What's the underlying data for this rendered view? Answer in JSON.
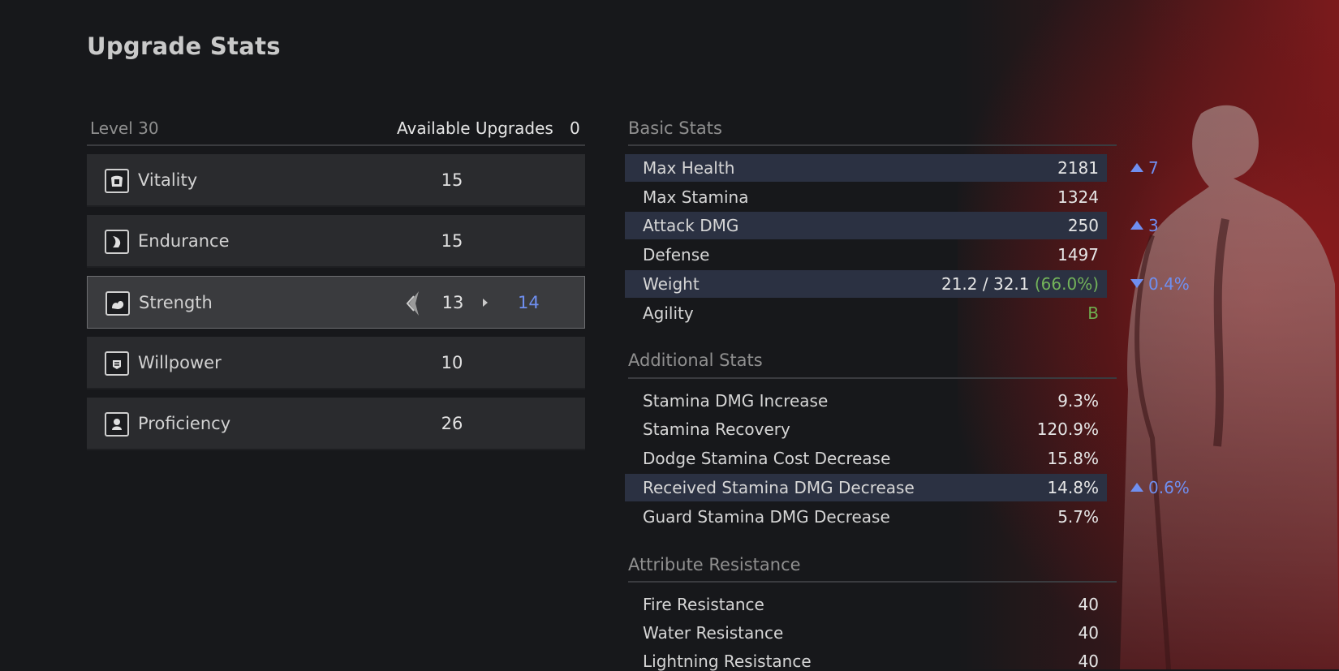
{
  "screen": {
    "title": "Upgrade Stats"
  },
  "colors": {
    "accent_blue": "#6f8ff0",
    "good_green": "#73b35a",
    "highlight_row": "#2b3142"
  },
  "left_panel": {
    "level_label": "Level 30",
    "available_label": "Available Upgrades",
    "available_value": "0",
    "attributes": [
      {
        "name": "Vitality",
        "value": "15",
        "icon": "vitality-icon"
      },
      {
        "name": "Endurance",
        "value": "15",
        "icon": "endurance-icon"
      },
      {
        "name": "Strength",
        "value": "13",
        "new_value": "14",
        "icon": "strength-icon",
        "selected": true
      },
      {
        "name": "Willpower",
        "value": "10",
        "icon": "willpower-icon"
      },
      {
        "name": "Proficiency",
        "value": "26",
        "icon": "proficiency-icon"
      }
    ]
  },
  "basic_stats": {
    "heading": "Basic Stats",
    "rows": [
      {
        "label": "Max Health",
        "value": "2181",
        "delta": "7",
        "dir": "up",
        "highlight": true
      },
      {
        "label": "Max Stamina",
        "value": "1324"
      },
      {
        "label": "Attack DMG",
        "value": "250",
        "delta": "3",
        "dir": "up",
        "highlight": true
      },
      {
        "label": "Defense",
        "value": "1497"
      },
      {
        "label": "Weight",
        "value": "21.2 / 32.1",
        "value_pct": "(66.0%)",
        "delta": "0.4%",
        "dir": "down",
        "highlight": true
      },
      {
        "label": "Agility",
        "value": "B"
      }
    ]
  },
  "additional_stats": {
    "heading": "Additional Stats",
    "rows": [
      {
        "label": "Stamina DMG Increase",
        "value": "9.3%"
      },
      {
        "label": "Stamina Recovery",
        "value": "120.9%"
      },
      {
        "label": "Dodge Stamina Cost Decrease",
        "value": "15.8%"
      },
      {
        "label": "Received Stamina DMG Decrease",
        "value": "14.8%",
        "delta": "0.6%",
        "dir": "up",
        "highlight": true
      },
      {
        "label": "Guard Stamina DMG Decrease",
        "value": "5.7%"
      }
    ]
  },
  "attribute_resistance": {
    "heading": "Attribute Resistance",
    "rows": [
      {
        "label": "Fire Resistance",
        "value": "40"
      },
      {
        "label": "Water Resistance",
        "value": "40"
      },
      {
        "label": "Lightning Resistance",
        "value": "40"
      }
    ]
  }
}
